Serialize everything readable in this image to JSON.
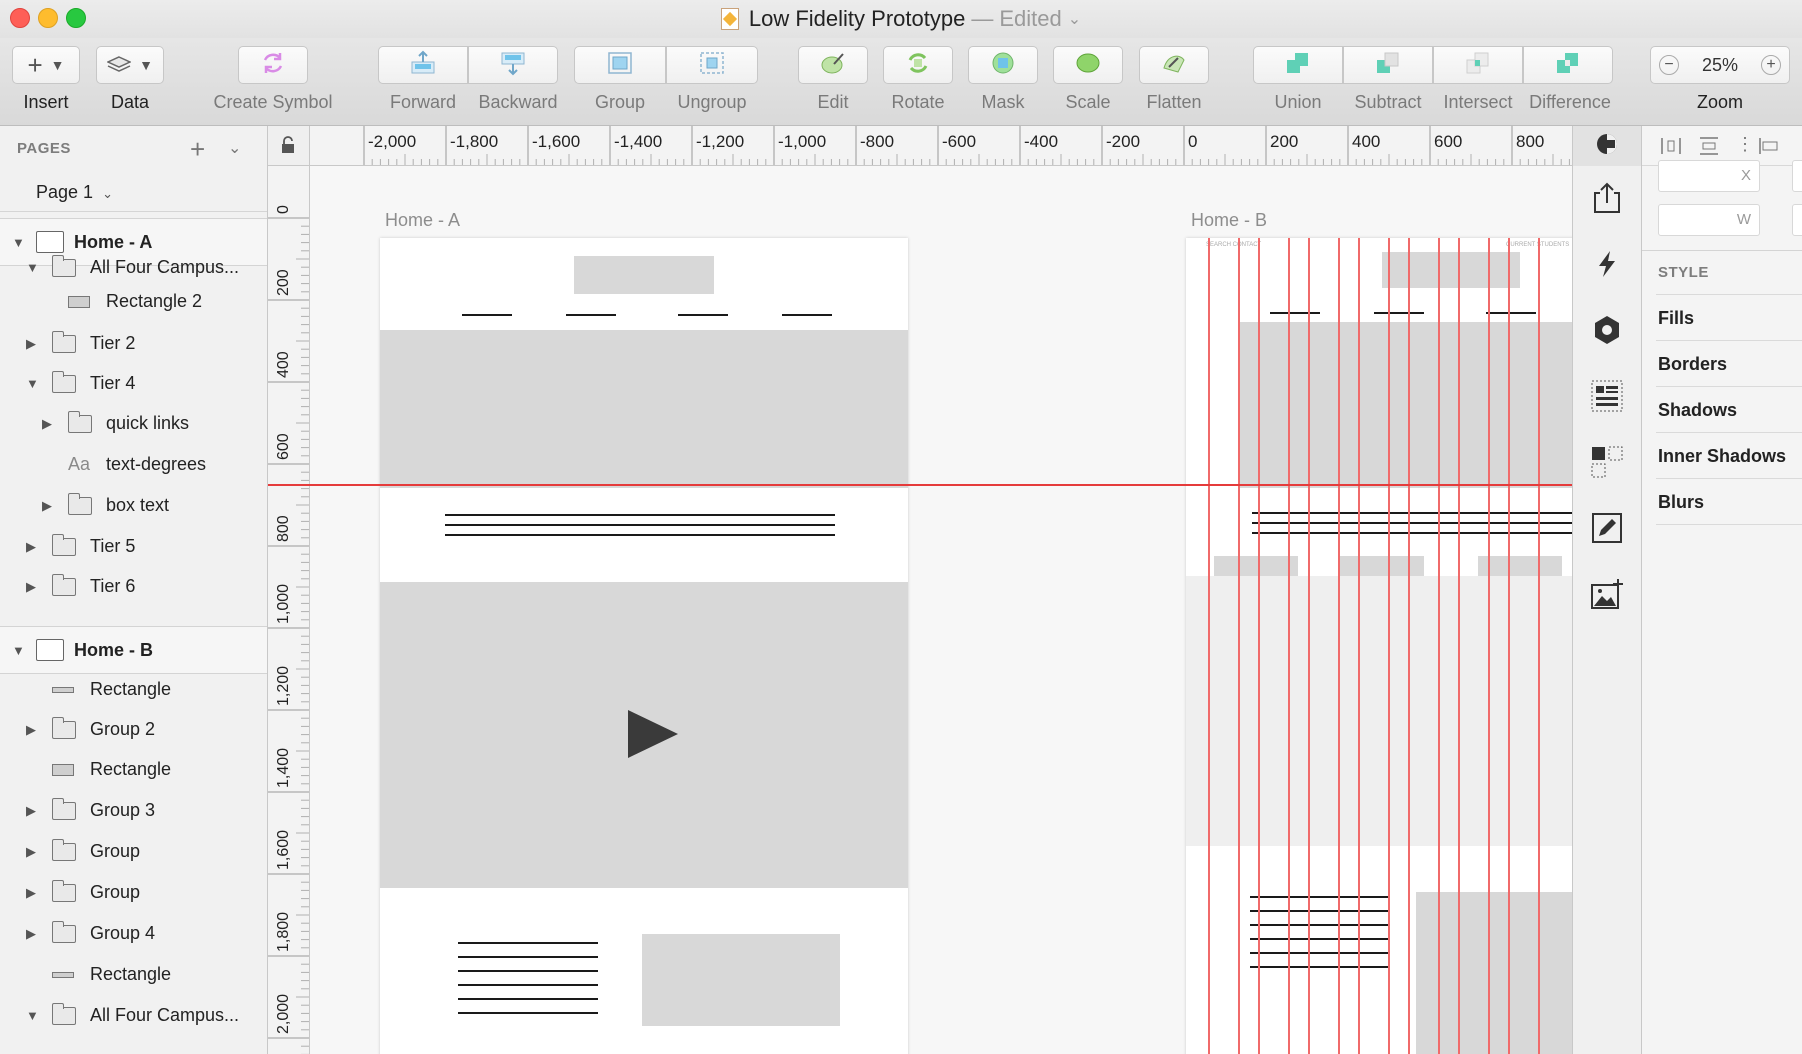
{
  "window": {
    "title": "Low Fidelity Prototype",
    "title_sep": "—",
    "status": "Edited",
    "colors": {
      "close": "#fe5f57",
      "minimize": "#febc2e",
      "zoom": "#28c840"
    }
  },
  "toolbar": {
    "insert": "Insert",
    "data": "Data",
    "create_symbol": "Create Symbol",
    "forward": "Forward",
    "backward": "Backward",
    "group": "Group",
    "ungroup": "Ungroup",
    "edit": "Edit",
    "rotate": "Rotate",
    "mask": "Mask",
    "scale": "Scale",
    "flatten": "Flatten",
    "union": "Union",
    "subtract": "Subtract",
    "intersect": "Intersect",
    "difference": "Difference",
    "zoom_label": "Zoom",
    "zoom_value": "25%"
  },
  "pages": {
    "header": "PAGES",
    "current_page": "Page 1"
  },
  "layers": [
    {
      "name": "Home - A",
      "kind": "artboard",
      "expanded": true
    },
    {
      "name": "All Four Campus...",
      "kind": "folder",
      "expanded": true
    },
    {
      "name": "Rectangle 2",
      "kind": "rect"
    },
    {
      "name": "Tier 2",
      "kind": "folder",
      "expanded": false
    },
    {
      "name": "Tier 4",
      "kind": "folder",
      "expanded": true
    },
    {
      "name": "quick links",
      "kind": "folder",
      "expanded": false
    },
    {
      "name": "text-degrees",
      "kind": "text",
      "icon_text": "Aa"
    },
    {
      "name": "box text",
      "kind": "folder",
      "expanded": false
    },
    {
      "name": "Tier 5",
      "kind": "folder",
      "expanded": false
    },
    {
      "name": "Tier 6",
      "kind": "folder",
      "expanded": false
    },
    {
      "name": "Home - B",
      "kind": "artboard",
      "expanded": true
    },
    {
      "name": "Rectangle",
      "kind": "line"
    },
    {
      "name": "Group 2",
      "kind": "folder",
      "expanded": false
    },
    {
      "name": "Rectangle",
      "kind": "rect"
    },
    {
      "name": "Group 3",
      "kind": "folder",
      "expanded": false
    },
    {
      "name": "Group",
      "kind": "folder",
      "expanded": false
    },
    {
      "name": "Group",
      "kind": "folder",
      "expanded": false
    },
    {
      "name": "Group 4",
      "kind": "folder",
      "expanded": false
    },
    {
      "name": "Rectangle",
      "kind": "line"
    },
    {
      "name": "All Four Campus...",
      "kind": "folder",
      "expanded": true
    }
  ],
  "ruler": {
    "h_labels": [
      "-2,000",
      "-1,800",
      "-1,600",
      "-1,400",
      "-1,200",
      "-1,000",
      "-800",
      "-600",
      "-400",
      "-200",
      "0",
      "200",
      "400",
      "600",
      "800"
    ],
    "v_labels": [
      "0",
      "200",
      "400",
      "600",
      "800",
      "1,000",
      "1,200",
      "1,400",
      "1,600",
      "1,800",
      "2,000"
    ]
  },
  "canvas": {
    "artboard_a": "Home - A",
    "artboard_b": "Home - B",
    "guide_color": "#f06a6a",
    "wire_tiny_left": "SEARCH  CONTACT",
    "wire_tiny_right": "CURRENT STUDENTS"
  },
  "inspector": {
    "x_label": "X",
    "w_label": "W",
    "style_header": "STYLE",
    "sections": [
      "Fills",
      "Borders",
      "Shadows",
      "Inner Shadows",
      "Blurs"
    ]
  }
}
